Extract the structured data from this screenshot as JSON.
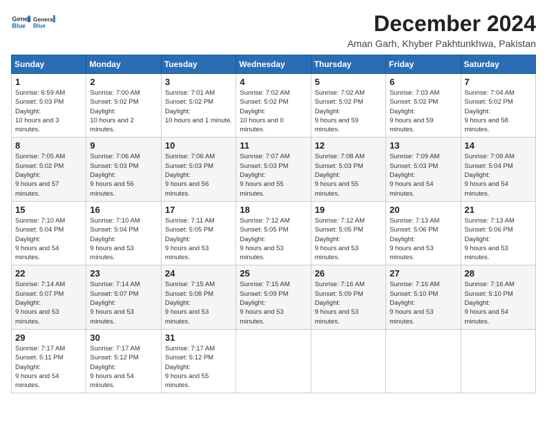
{
  "header": {
    "logo_line1": "General",
    "logo_line2": "Blue",
    "title": "December 2024",
    "subtitle": "Aman Garh, Khyber Pakhtunkhwa, Pakistan"
  },
  "weekdays": [
    "Sunday",
    "Monday",
    "Tuesday",
    "Wednesday",
    "Thursday",
    "Friday",
    "Saturday"
  ],
  "weeks": [
    [
      {
        "day": "1",
        "sunrise": "6:59 AM",
        "sunset": "5:03 PM",
        "daylight": "10 hours and 3 minutes."
      },
      {
        "day": "2",
        "sunrise": "7:00 AM",
        "sunset": "5:02 PM",
        "daylight": "10 hours and 2 minutes."
      },
      {
        "day": "3",
        "sunrise": "7:01 AM",
        "sunset": "5:02 PM",
        "daylight": "10 hours and 1 minute."
      },
      {
        "day": "4",
        "sunrise": "7:02 AM",
        "sunset": "5:02 PM",
        "daylight": "10 hours and 0 minutes."
      },
      {
        "day": "5",
        "sunrise": "7:02 AM",
        "sunset": "5:02 PM",
        "daylight": "9 hours and 59 minutes."
      },
      {
        "day": "6",
        "sunrise": "7:03 AM",
        "sunset": "5:02 PM",
        "daylight": "9 hours and 59 minutes."
      },
      {
        "day": "7",
        "sunrise": "7:04 AM",
        "sunset": "5:02 PM",
        "daylight": "9 hours and 58 minutes."
      }
    ],
    [
      {
        "day": "8",
        "sunrise": "7:05 AM",
        "sunset": "5:02 PM",
        "daylight": "9 hours and 57 minutes."
      },
      {
        "day": "9",
        "sunrise": "7:06 AM",
        "sunset": "5:03 PM",
        "daylight": "9 hours and 56 minutes."
      },
      {
        "day": "10",
        "sunrise": "7:06 AM",
        "sunset": "5:03 PM",
        "daylight": "9 hours and 56 minutes."
      },
      {
        "day": "11",
        "sunrise": "7:07 AM",
        "sunset": "5:03 PM",
        "daylight": "9 hours and 55 minutes."
      },
      {
        "day": "12",
        "sunrise": "7:08 AM",
        "sunset": "5:03 PM",
        "daylight": "9 hours and 55 minutes."
      },
      {
        "day": "13",
        "sunrise": "7:09 AM",
        "sunset": "5:03 PM",
        "daylight": "9 hours and 54 minutes."
      },
      {
        "day": "14",
        "sunrise": "7:09 AM",
        "sunset": "5:04 PM",
        "daylight": "9 hours and 54 minutes."
      }
    ],
    [
      {
        "day": "15",
        "sunrise": "7:10 AM",
        "sunset": "5:04 PM",
        "daylight": "9 hours and 54 minutes."
      },
      {
        "day": "16",
        "sunrise": "7:10 AM",
        "sunset": "5:04 PM",
        "daylight": "9 hours and 53 minutes."
      },
      {
        "day": "17",
        "sunrise": "7:11 AM",
        "sunset": "5:05 PM",
        "daylight": "9 hours and 53 minutes."
      },
      {
        "day": "18",
        "sunrise": "7:12 AM",
        "sunset": "5:05 PM",
        "daylight": "9 hours and 53 minutes."
      },
      {
        "day": "19",
        "sunrise": "7:12 AM",
        "sunset": "5:05 PM",
        "daylight": "9 hours and 53 minutes."
      },
      {
        "day": "20",
        "sunrise": "7:13 AM",
        "sunset": "5:06 PM",
        "daylight": "9 hours and 53 minutes."
      },
      {
        "day": "21",
        "sunrise": "7:13 AM",
        "sunset": "5:06 PM",
        "daylight": "9 hours and 53 minutes."
      }
    ],
    [
      {
        "day": "22",
        "sunrise": "7:14 AM",
        "sunset": "5:07 PM",
        "daylight": "9 hours and 53 minutes."
      },
      {
        "day": "23",
        "sunrise": "7:14 AM",
        "sunset": "5:07 PM",
        "daylight": "9 hours and 53 minutes."
      },
      {
        "day": "24",
        "sunrise": "7:15 AM",
        "sunset": "5:08 PM",
        "daylight": "9 hours and 53 minutes."
      },
      {
        "day": "25",
        "sunrise": "7:15 AM",
        "sunset": "5:09 PM",
        "daylight": "9 hours and 53 minutes."
      },
      {
        "day": "26",
        "sunrise": "7:16 AM",
        "sunset": "5:09 PM",
        "daylight": "9 hours and 53 minutes."
      },
      {
        "day": "27",
        "sunrise": "7:16 AM",
        "sunset": "5:10 PM",
        "daylight": "9 hours and 53 minutes."
      },
      {
        "day": "28",
        "sunrise": "7:16 AM",
        "sunset": "5:10 PM",
        "daylight": "9 hours and 54 minutes."
      }
    ],
    [
      {
        "day": "29",
        "sunrise": "7:17 AM",
        "sunset": "5:11 PM",
        "daylight": "9 hours and 54 minutes."
      },
      {
        "day": "30",
        "sunrise": "7:17 AM",
        "sunset": "5:12 PM",
        "daylight": "9 hours and 54 minutes."
      },
      {
        "day": "31",
        "sunrise": "7:17 AM",
        "sunset": "5:12 PM",
        "daylight": "9 hours and 55 minutes."
      },
      null,
      null,
      null,
      null
    ]
  ],
  "labels": {
    "sunrise": "Sunrise:",
    "sunset": "Sunset:",
    "daylight": "Daylight:"
  }
}
